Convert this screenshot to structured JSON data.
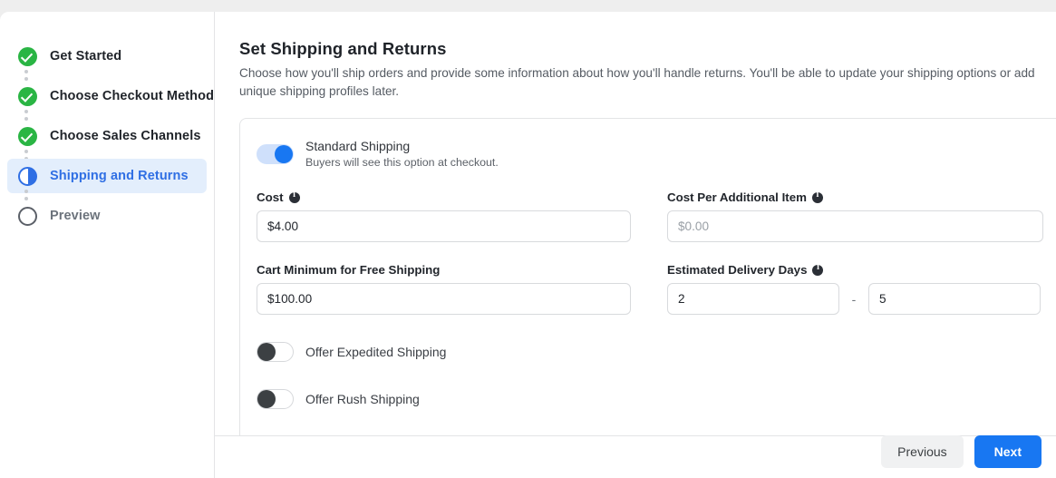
{
  "sidebar": {
    "steps": [
      {
        "label": "Get Started",
        "state": "done",
        "icon": "check-circle-icon"
      },
      {
        "label": "Choose Checkout Method",
        "state": "done",
        "icon": "check-circle-icon"
      },
      {
        "label": "Choose Sales Channels",
        "state": "done",
        "icon": "check-circle-icon"
      },
      {
        "label": "Shipping and Returns",
        "state": "current",
        "icon": "half-circle-icon"
      },
      {
        "label": "Preview",
        "state": "todo",
        "icon": "empty-circle-icon"
      }
    ]
  },
  "main": {
    "title": "Set Shipping and Returns",
    "subtitle": "Choose how you'll ship orders and provide some information about how you'll handle returns. You'll be able to update your shipping options or add unique shipping profiles later."
  },
  "shipping_card": {
    "standard_shipping": {
      "title": "Standard Shipping",
      "subtitle": "Buyers will see this option at checkout.",
      "enabled": true
    },
    "fields": {
      "cost": {
        "label": "Cost",
        "has_info": true,
        "value": "$4.00",
        "placeholder": ""
      },
      "cost_per_additional_item": {
        "label": "Cost Per Additional Item",
        "has_info": true,
        "value": "",
        "placeholder": "$0.00"
      },
      "cart_minimum": {
        "label": "Cart Minimum for Free Shipping",
        "has_info": false,
        "value": "$100.00",
        "placeholder": ""
      },
      "estimated_delivery_days": {
        "label": "Estimated Delivery Days",
        "has_info": true,
        "min_value": "2",
        "max_value": "5",
        "separator": "-"
      }
    },
    "expedited_shipping": {
      "label": "Offer Expedited Shipping",
      "enabled": false
    },
    "rush_shipping": {
      "label": "Offer Rush Shipping",
      "enabled": false
    }
  },
  "footer": {
    "previous_label": "Previous",
    "next_label": "Next"
  },
  "colors": {
    "accent_blue": "#1877f2",
    "active_blue": "#2f6fe4",
    "done_green": "#2ab544",
    "active_pill": "#e3eefc"
  }
}
